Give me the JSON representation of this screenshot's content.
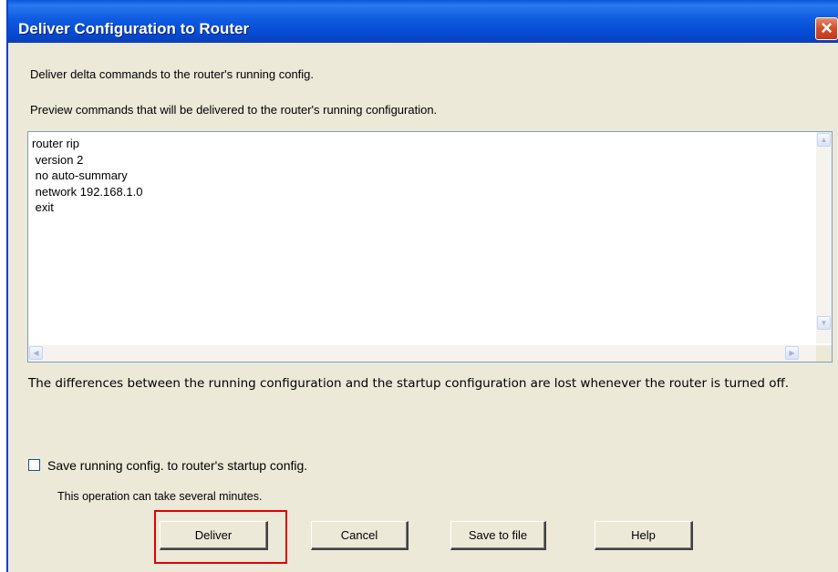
{
  "window": {
    "title": "Deliver Configuration to Router",
    "close_icon": "close-icon"
  },
  "description": "Deliver delta commands to the router's running config.",
  "preview": {
    "label": "Preview commands that will be delivered to the router's running configuration.",
    "lines": [
      "router rip",
      " version 2",
      " no auto-summary",
      " network 192.168.1.0",
      " exit"
    ]
  },
  "info_text": "The differences between the running configuration and the startup configuration are lost whenever the router is turned off.",
  "save_option": {
    "label": "Save running config. to router's startup config.",
    "checked": false,
    "note": "This operation can take several minutes."
  },
  "buttons": {
    "deliver": "Deliver",
    "cancel": "Cancel",
    "save_to_file": "Save to file",
    "help": "Help"
  },
  "colors": {
    "titlebar": "#0a57dd",
    "highlight": "#e00000",
    "close": "#d4512c"
  }
}
